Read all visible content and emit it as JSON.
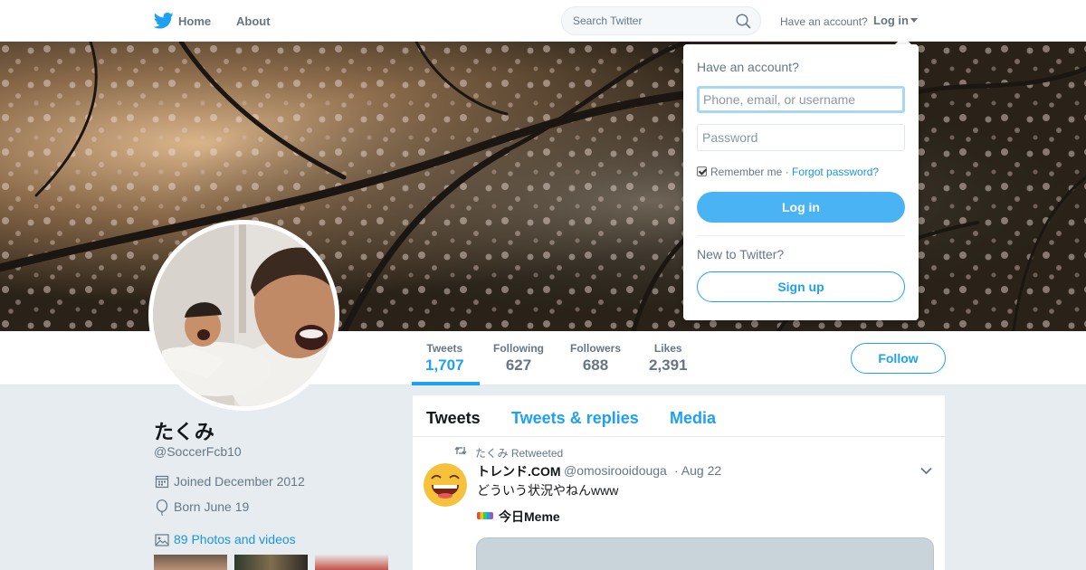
{
  "nav": {
    "home_label": "Home",
    "about_label": "About",
    "search_placeholder": "Search Twitter",
    "have_account": "Have an account?",
    "login_label": "Log in"
  },
  "profile": {
    "name": "たくみ",
    "handle": "@SoccerFcb10",
    "joined": "Joined December 2012",
    "born": "Born June 19",
    "photos_link": "89 Photos and videos"
  },
  "stats": [
    {
      "label": "Tweets",
      "value": "1,707"
    },
    {
      "label": "Following",
      "value": "627"
    },
    {
      "label": "Followers",
      "value": "688"
    },
    {
      "label": "Likes",
      "value": "2,391"
    }
  ],
  "follow_label": "Follow",
  "timeline": {
    "tabs": [
      "Tweets",
      "Tweets & replies",
      "Media"
    ],
    "tweet": {
      "retweet_text": "たくみ Retweeted",
      "author_name": "トレンド.COM",
      "author_handle": "@omosirooidouga",
      "date": "· Aug 22",
      "text": "どういう状況やねんwww",
      "meme_label": "今日Meme"
    }
  },
  "login_dropdown": {
    "heading": "Have an account?",
    "username_placeholder": "Phone, email, or username",
    "password_placeholder": "Password",
    "remember_me": "Remember me",
    "separator": " · ",
    "forgot_password": "Forgot password?",
    "login_button": "Log in",
    "new_to_twitter": "New to Twitter?",
    "signup_button": "Sign up"
  },
  "colors": {
    "accent": "#1da1f2",
    "login_button_bg": "#4ab3f4",
    "background": "#e6ecf0"
  },
  "icons": [
    "twitter-bird-icon",
    "search-icon",
    "caret-down-icon",
    "calendar-icon",
    "balloon-icon",
    "photo-icon",
    "retweet-icon",
    "chevron-down-icon"
  ]
}
